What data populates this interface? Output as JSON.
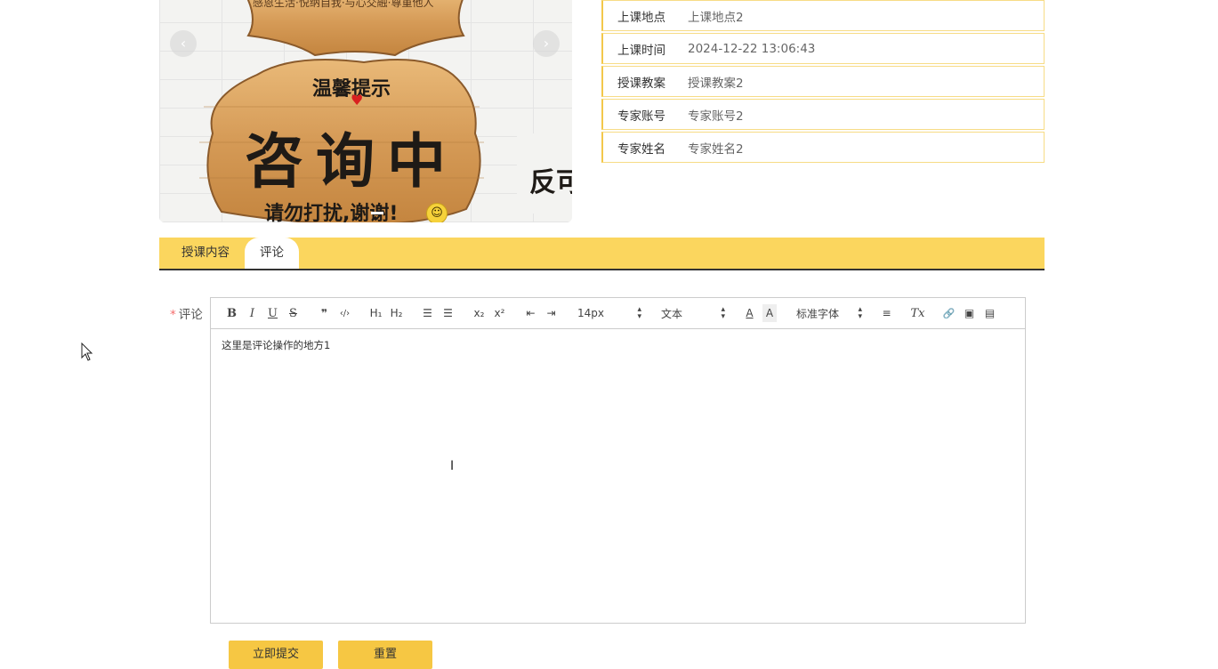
{
  "carousel": {
    "prev_icon": "‹",
    "next_icon": "›",
    "image_text": {
      "top_line": "感恩生活·悦纳自我·与心交融·尊重他人",
      "hint": "温馨提示",
      "main": "咨询中",
      "side": "反可",
      "footer": "请勿打扰,谢谢!",
      "smiley": "☺"
    },
    "icons": {
      "prev": "chevron-left-icon",
      "next": "chevron-right-icon"
    }
  },
  "info": {
    "rows": [
      {
        "label": "上课地点",
        "value": "上课地点2"
      },
      {
        "label": "上课时间",
        "value": "2024-12-22 13:06:43"
      },
      {
        "label": "授课教案",
        "value": "授课教案2"
      },
      {
        "label": "专家账号",
        "value": "专家账号2"
      },
      {
        "label": "专家姓名",
        "value": "专家姓名2"
      }
    ]
  },
  "tabs": [
    {
      "label": "授课内容",
      "active": false
    },
    {
      "label": "评论",
      "active": true
    }
  ],
  "form": {
    "required_mark": "*",
    "comment_label": "评论",
    "editor": {
      "content": "这里是评论操作的地方1",
      "toolbar": {
        "bold": "B",
        "italic": "I",
        "underline": "U",
        "strike": "S",
        "blockquote": "❞",
        "code": "‹/›",
        "h1": "H₁",
        "h2": "H₂",
        "ordered_list": "☰",
        "bullet_list": "☰",
        "subscript": "x₂",
        "superscript": "x²",
        "outdent": "⇤",
        "indent": "⇥",
        "size_select": "14px",
        "header_select": "文本",
        "font_color": "A",
        "background_color": "A",
        "font_select": "标准字体",
        "align": "≡",
        "clean": "Tx",
        "link": "🔗",
        "image": "▣",
        "video": "▤"
      }
    },
    "submit_label": "立即提交",
    "reset_label": "重置"
  },
  "colors": {
    "accent": "#fbd65e",
    "button": "#f6c743",
    "info_border": "#f7dc86",
    "required": "#f56c6c"
  }
}
